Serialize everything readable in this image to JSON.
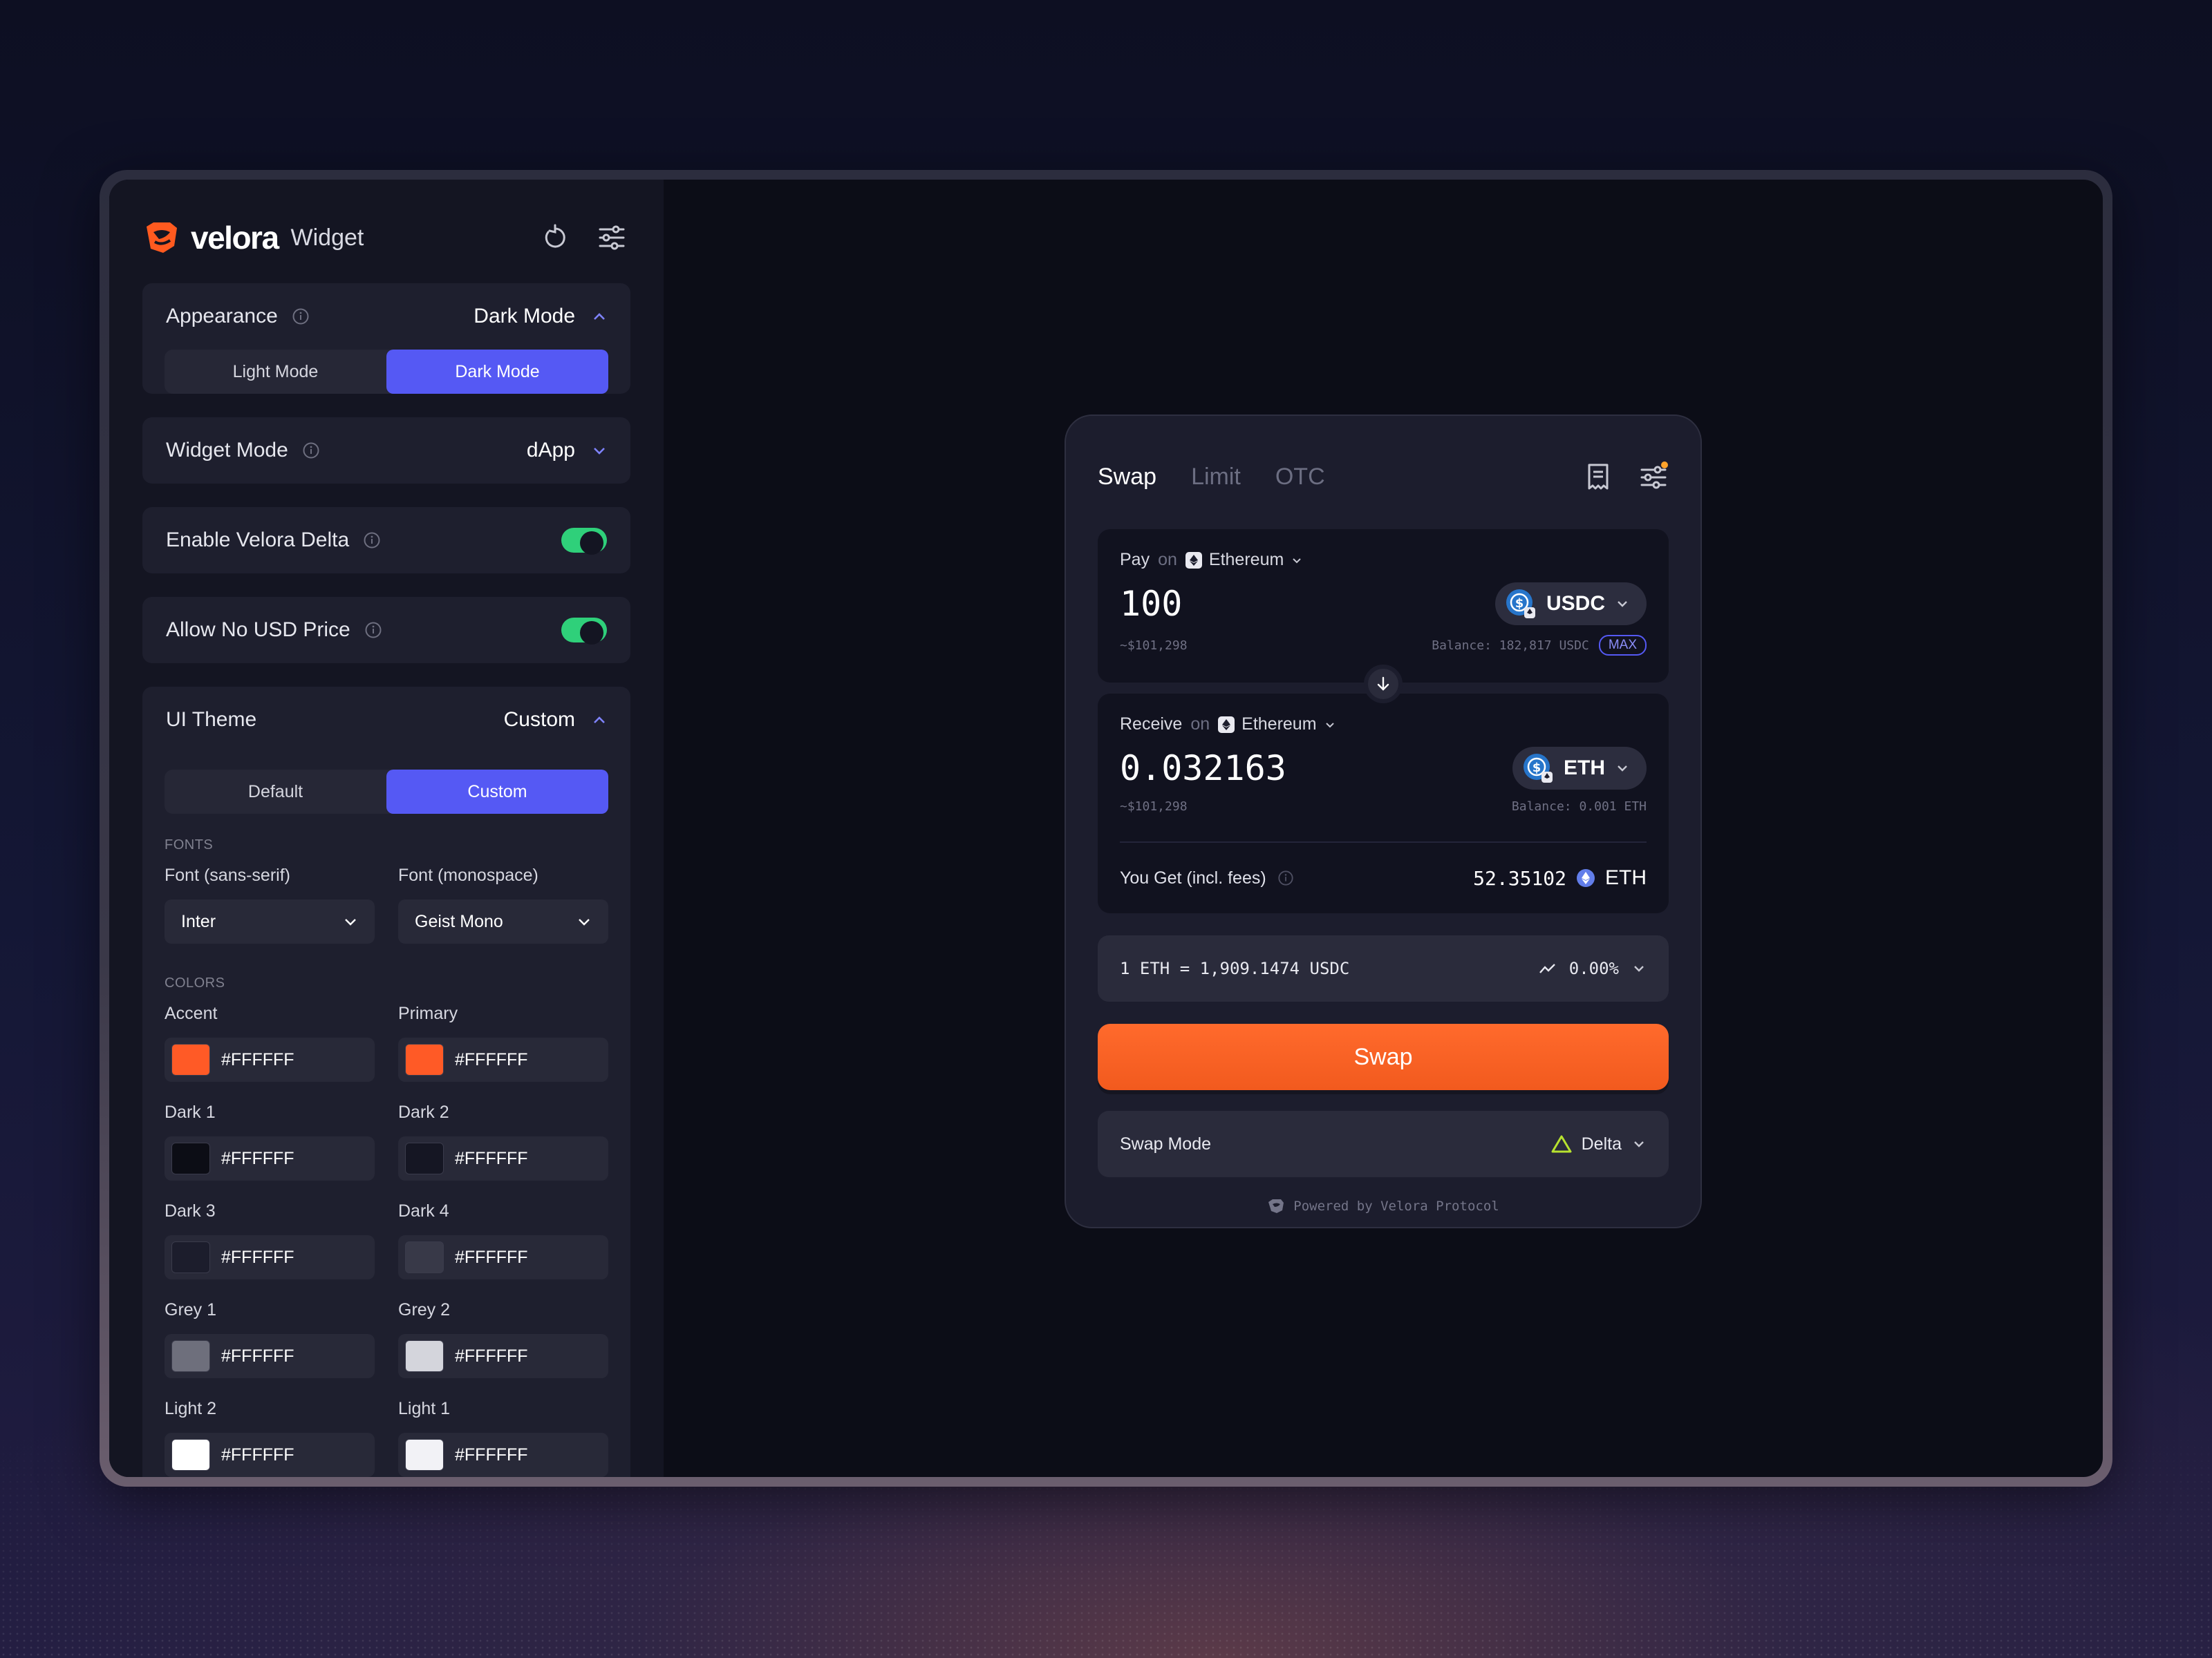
{
  "colors": {
    "accent": "#FF6A2C",
    "primary": "#5559F4",
    "toggle_on": "#2FD07A",
    "delta": "#B7E22F"
  },
  "sidebar": {
    "brand_name": "velora",
    "brand_sub": "Widget",
    "appearance": {
      "label": "Appearance",
      "value": "Dark Mode",
      "options": [
        "Light Mode",
        "Dark Mode"
      ],
      "selected": "Dark Mode"
    },
    "widget_mode": {
      "label": "Widget Mode",
      "value": "dApp"
    },
    "enable_delta": {
      "label": "Enable Velora Delta",
      "on": true
    },
    "allow_no_usd": {
      "label": "Allow No USD Price",
      "on": true
    },
    "ui_theme": {
      "label": "UI Theme",
      "value": "Custom",
      "options": [
        "Default",
        "Custom"
      ],
      "selected": "Custom",
      "fonts_label": "FONTS",
      "font_sans_label": "Font (sans-serif)",
      "font_sans_value": "Inter",
      "font_mono_label": "Font (monospace)",
      "font_mono_value": "Geist Mono",
      "colors_label": "COLORS",
      "color_fields": [
        {
          "label": "Accent",
          "value": "#FFFFFF",
          "swatch": "#FF5A26"
        },
        {
          "label": "Primary",
          "value": "#FFFFFF",
          "swatch": "#FF5A26"
        },
        {
          "label": "Dark 1",
          "value": "#FFFFFF",
          "swatch": "#0c0d15"
        },
        {
          "label": "Dark 2",
          "value": "#FFFFFF",
          "swatch": "#151623"
        },
        {
          "label": "Dark 3",
          "value": "#FFFFFF",
          "swatch": "#1c1d2c"
        },
        {
          "label": "Dark 4",
          "value": "#FFFFFF",
          "swatch": "#383948"
        },
        {
          "label": "Grey 1",
          "value": "#FFFFFF",
          "swatch": "#6e6f7c"
        },
        {
          "label": "Grey 2",
          "value": "#FFFFFF",
          "swatch": "#d4d5dc"
        },
        {
          "label": "Light 2",
          "value": "#FFFFFF",
          "swatch": "#ffffff"
        },
        {
          "label": "Light 1",
          "value": "#FFFFFF",
          "swatch": "#f2f2f6"
        }
      ]
    }
  },
  "widget": {
    "tabs": [
      "Swap",
      "Limit",
      "OTC"
    ],
    "active_tab": "Swap",
    "pay": {
      "label": "Pay",
      "on": "on",
      "chain": "Ethereum",
      "amount": "100",
      "token": "USDC",
      "usd": "~$101,298",
      "balance": "Balance: 182,817 USDC",
      "max": "MAX"
    },
    "receive": {
      "label": "Receive",
      "on": "on",
      "chain": "Ethereum",
      "amount": "0.032163",
      "token": "ETH",
      "usd": "~$101,298",
      "balance": "Balance: 0.001 ETH"
    },
    "you_get": {
      "label": "You Get (incl. fees)",
      "value": "52.35102",
      "token": "ETH"
    },
    "rate": {
      "text": "1 ETH = 1,909.1474 USDC",
      "change": "0.00%"
    },
    "swap_button": "Swap",
    "swap_mode": {
      "label": "Swap Mode",
      "value": "Delta"
    },
    "powered": "Powered by Velora Protocol"
  }
}
